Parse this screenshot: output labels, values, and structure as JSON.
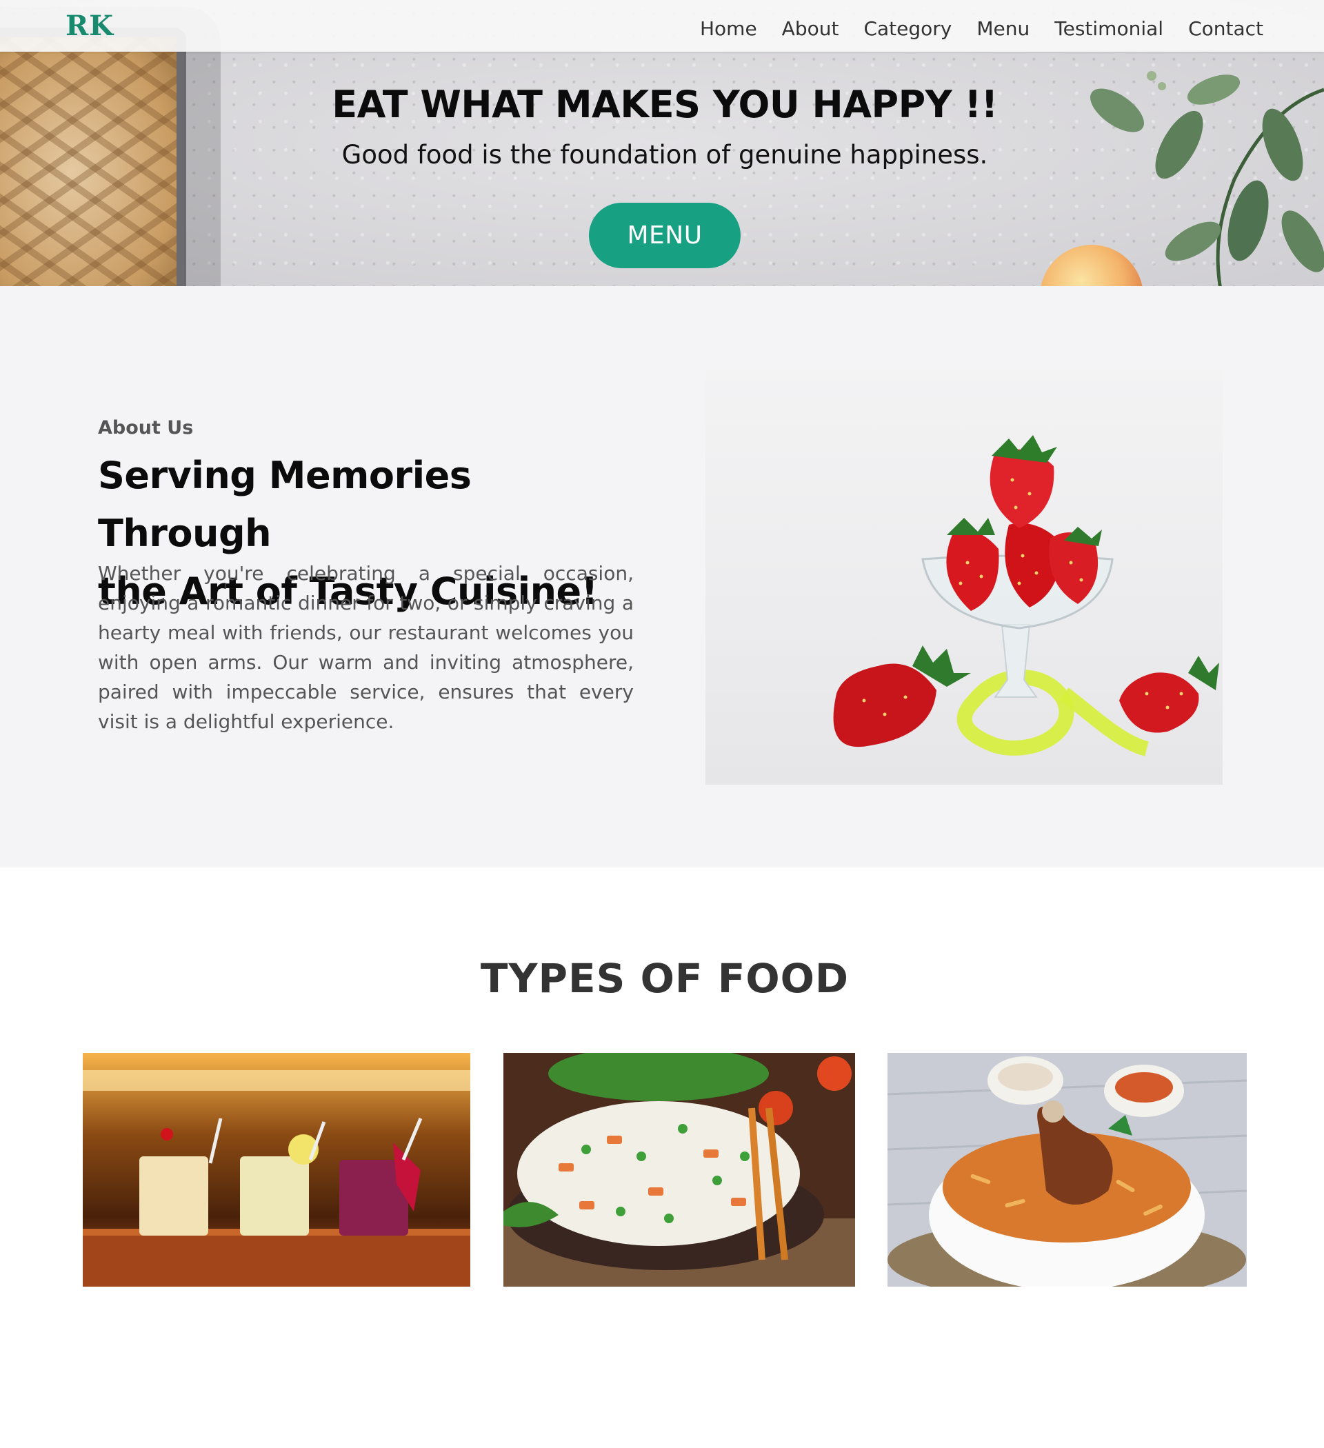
{
  "brand": {
    "logo": "RK",
    "accent_color": "#18a083"
  },
  "nav": {
    "items": [
      "Home",
      "About",
      "Category",
      "Menu",
      "Testimonial",
      "Contact"
    ]
  },
  "hero": {
    "title": "EAT WHAT MAKES YOU HAPPY !!",
    "subtitle": "Good food is the foundation of genuine happiness.",
    "button_label": "MENU"
  },
  "about": {
    "kicker": "About Us",
    "heading_line1": "Serving Memories Through",
    "heading_line2": "the Art of Tasty Cuisine!",
    "body": "Whether you're celebrating a special occasion, enjoying a romantic dinner for two, or simply craving a hearty meal with friends, our restaurant welcomes you with open arms. Our warm and inviting atmosphere, paired with impeccable service, ensures that every visit is a delightful experience.",
    "image_subject": "strawberries in a glass bowl"
  },
  "types": {
    "title": "TYPES OF FOOD",
    "cards": [
      {
        "subject": "cocktails"
      },
      {
        "subject": "vegetable fried rice"
      },
      {
        "subject": "chicken biryani"
      }
    ]
  }
}
